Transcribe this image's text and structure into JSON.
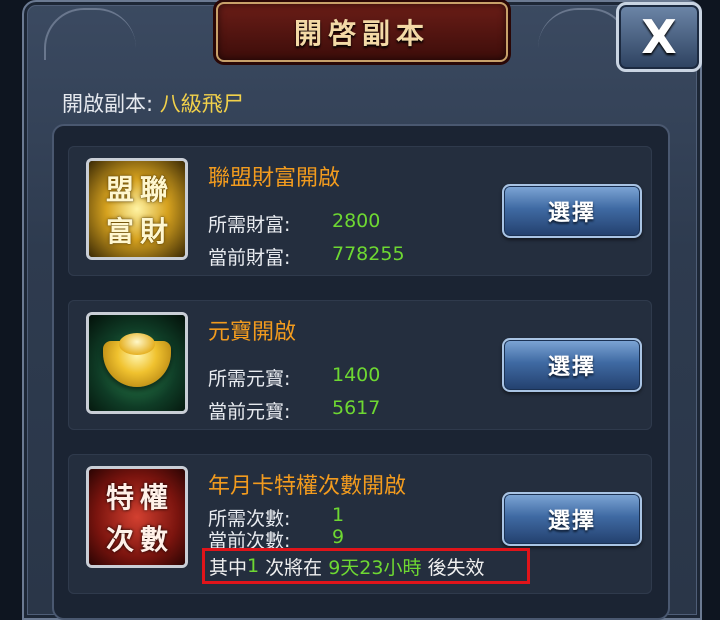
{
  "dialog": {
    "title": "開啓副本",
    "close_label": "X"
  },
  "dungeon": {
    "label": "開啟副本:",
    "name": "八級飛尸"
  },
  "options": [
    {
      "title": "聯盟財富開啟",
      "icon": "alliance-wealth-icon",
      "icon_chars": [
        "聯",
        "盟",
        "財",
        "富"
      ],
      "rows": [
        {
          "label": "所需財富:",
          "value": "2800"
        },
        {
          "label": "當前財富:",
          "value": "778255"
        }
      ],
      "button": "選擇"
    },
    {
      "title": "元寶開啟",
      "icon": "gold-ingot-icon",
      "rows": [
        {
          "label": "所需元寶:",
          "value": "1400"
        },
        {
          "label": "當前元寶:",
          "value": "5617"
        }
      ],
      "button": "選擇"
    },
    {
      "title": "年月卡特權次數開啟",
      "icon": "privilege-count-icon",
      "icon_chars": [
        "特",
        "權",
        "次",
        "數"
      ],
      "rows": [
        {
          "label": "所需次數:",
          "value": "1"
        },
        {
          "label": "當前次數:",
          "value": "9"
        }
      ],
      "button": "選擇"
    }
  ],
  "notice": {
    "prefix": "其中",
    "count": "1",
    "middle": "次將在",
    "duration": "9天23小時",
    "suffix": "後失效"
  },
  "colors": {
    "title_orange": "#f29b1e",
    "value_green": "#6ed832",
    "dungeon_yellow": "#f2d14a",
    "notice_border": "#e0141a"
  }
}
